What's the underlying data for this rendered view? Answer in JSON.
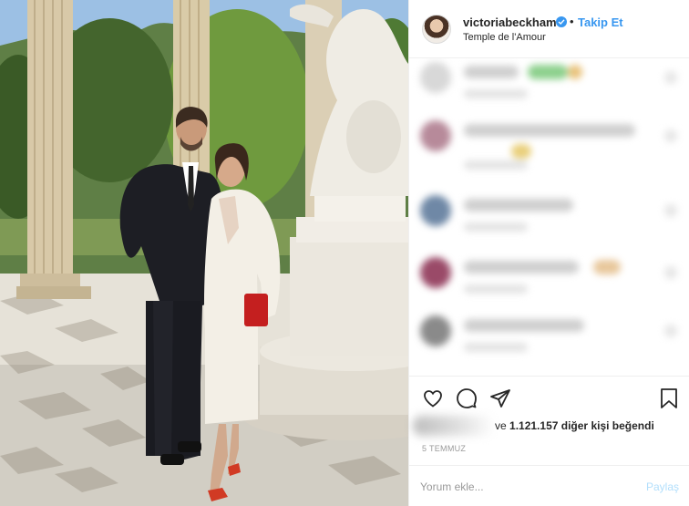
{
  "post": {
    "username": "victoriabeckham",
    "separator": "•",
    "follow_label": "Takip Et",
    "location": "Temple de l'Amour"
  },
  "engagement": {
    "likes_prefix": "ve",
    "likes_count": "1.121.157",
    "likes_suffix": "diğer kişi beğendi",
    "date": "5 TEMMUZ"
  },
  "comment_form": {
    "placeholder": "Yorum ekle...",
    "share_label": "Paylaş"
  },
  "icons": {
    "verified": "verified-badge-icon",
    "like": "heart-icon",
    "comment": "comment-bubble-icon",
    "share": "paper-plane-icon",
    "save": "bookmark-icon"
  },
  "colors": {
    "accent": "#3897f0",
    "share_disabled": "#b2dffc",
    "muted_text": "#999999",
    "border": "#efefef"
  }
}
